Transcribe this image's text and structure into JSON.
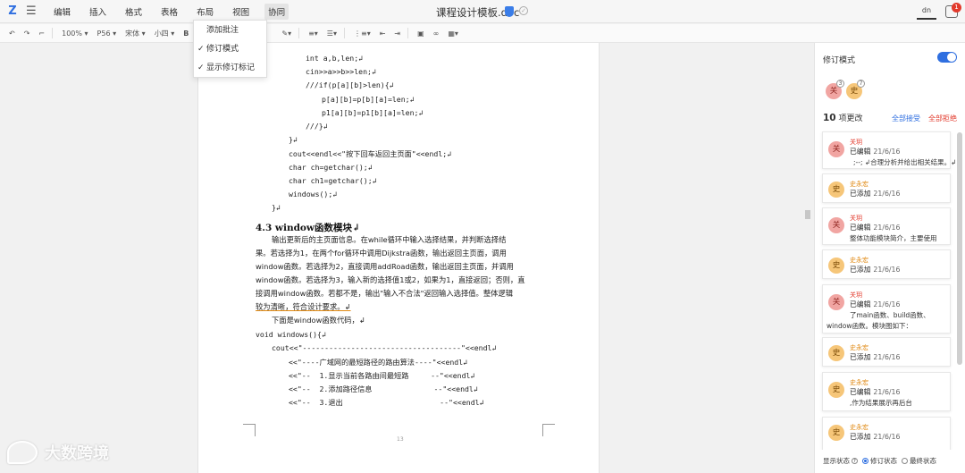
{
  "menubar": {
    "logo": "Z",
    "items": [
      "编辑",
      "插入",
      "格式",
      "表格",
      "布局",
      "视图",
      "协同"
    ],
    "doc_title": "课程设计模板.doc",
    "user": "dn",
    "notify_count": "1"
  },
  "toolbar": {
    "zoom": "100%",
    "style": "P56",
    "font": "宋体",
    "size": "小四",
    "bold": "B"
  },
  "dropdown": {
    "items": [
      "添加批注",
      "修订模式",
      "显示修订标记"
    ],
    "checked": [
      false,
      true,
      true
    ]
  },
  "document": {
    "code_top": [
      "int a,b,len;↲",
      "cin>>a>>b>>len;↲",
      "///if(p[a][b]>len){↲",
      "p[a][b]=p[b][a]=len;↲",
      "p1[a][b]=p1[b][a]=len;↲",
      "///}↲",
      "}↲",
      "cout<<endl<<\"按下回车返回主页面\"<<endl;↲",
      "char ch=getchar();↲",
      "char ch1=getchar();↲",
      "windows();↲",
      "}↲"
    ],
    "heading": "4.3   window函数模块↲",
    "paragraph": [
      "输出更新后的主页面信息。在while循环中输入选择结果，并判断选择结",
      "果。若选择为1，在两个for循环中调用Dijkstra函数，输出返回主页面，调用",
      "window函数。若选择为2，直接调用addRoad函数，输出返回主页面，并调用",
      "window函数。若选择为3，输入新的选择值1或2，如果为1，直接返回；否则，直",
      "接调用window函数。若都不是，输出\"输入不合法\"返回输入选择值。整体逻辑",
      "较为清晰，符合设计要求。↲",
      "下面是window函数代码，↲"
    ],
    "code_bottom": [
      "void windows(){↲",
      "cout<<\"------------------------------------\"<<endl↲",
      "<<\"----广域网的最短路径的路由算法----\"<<endl↲",
      "<<\"--  1.显示当前各路由间最短路     --\"<<endl↲",
      "<<\"--  2.添加路径信息              --\"<<endl↲",
      "<<\"--  3.退出                      --\"<<endl↲"
    ],
    "page_number": "13"
  },
  "panel": {
    "title": "修订模式",
    "authors": [
      {
        "initial": "关",
        "count": "3"
      },
      {
        "initial": "史",
        "count": "7"
      }
    ],
    "changes_count": "10",
    "changes_label": "项更改",
    "accept_all": "全部接受",
    "reject_all": "全部拒绝",
    "cards": [
      {
        "initial": "关",
        "name": "关玥",
        "action": "已编辑",
        "date": "21/6/16",
        "text": ";--; ↲合理分析并给出相关结果。↲"
      },
      {
        "initial": "史",
        "name": "史永宏",
        "action": "已添加",
        "date": "21/6/16",
        "text": ""
      },
      {
        "initial": "关",
        "name": "关玥",
        "action": "已编辑",
        "date": "21/6/16",
        "text": "整体功能模块简介，主要使用"
      },
      {
        "initial": "史",
        "name": "史永宏",
        "action": "已添加",
        "date": "21/6/16",
        "text": ""
      },
      {
        "initial": "关",
        "name": "关玥",
        "action": "已编辑",
        "date": "21/6/16",
        "text": "了main函数、build函数、",
        "text2": "window函数。模块图如下："
      },
      {
        "initial": "史",
        "name": "史永宏",
        "action": "已添加",
        "date": "21/6/16",
        "text": ""
      },
      {
        "initial": "史",
        "name": "史永宏",
        "action": "已编辑",
        "date": "21/6/16",
        "text": ",作为结果展示再后台"
      },
      {
        "initial": "史",
        "name": "史永宏",
        "action": "已添加",
        "date": "21/6/16",
        "text": ""
      }
    ],
    "footer": {
      "label": "显示状态",
      "opt1": "修订状态",
      "opt2": "最终状态"
    }
  },
  "watermark": "大数跨境",
  "colors": {
    "accent": "#2f6fe0",
    "reject": "#e23a2c",
    "avatar_red": "#f1a5a2",
    "avatar_orange": "#f6c679"
  }
}
